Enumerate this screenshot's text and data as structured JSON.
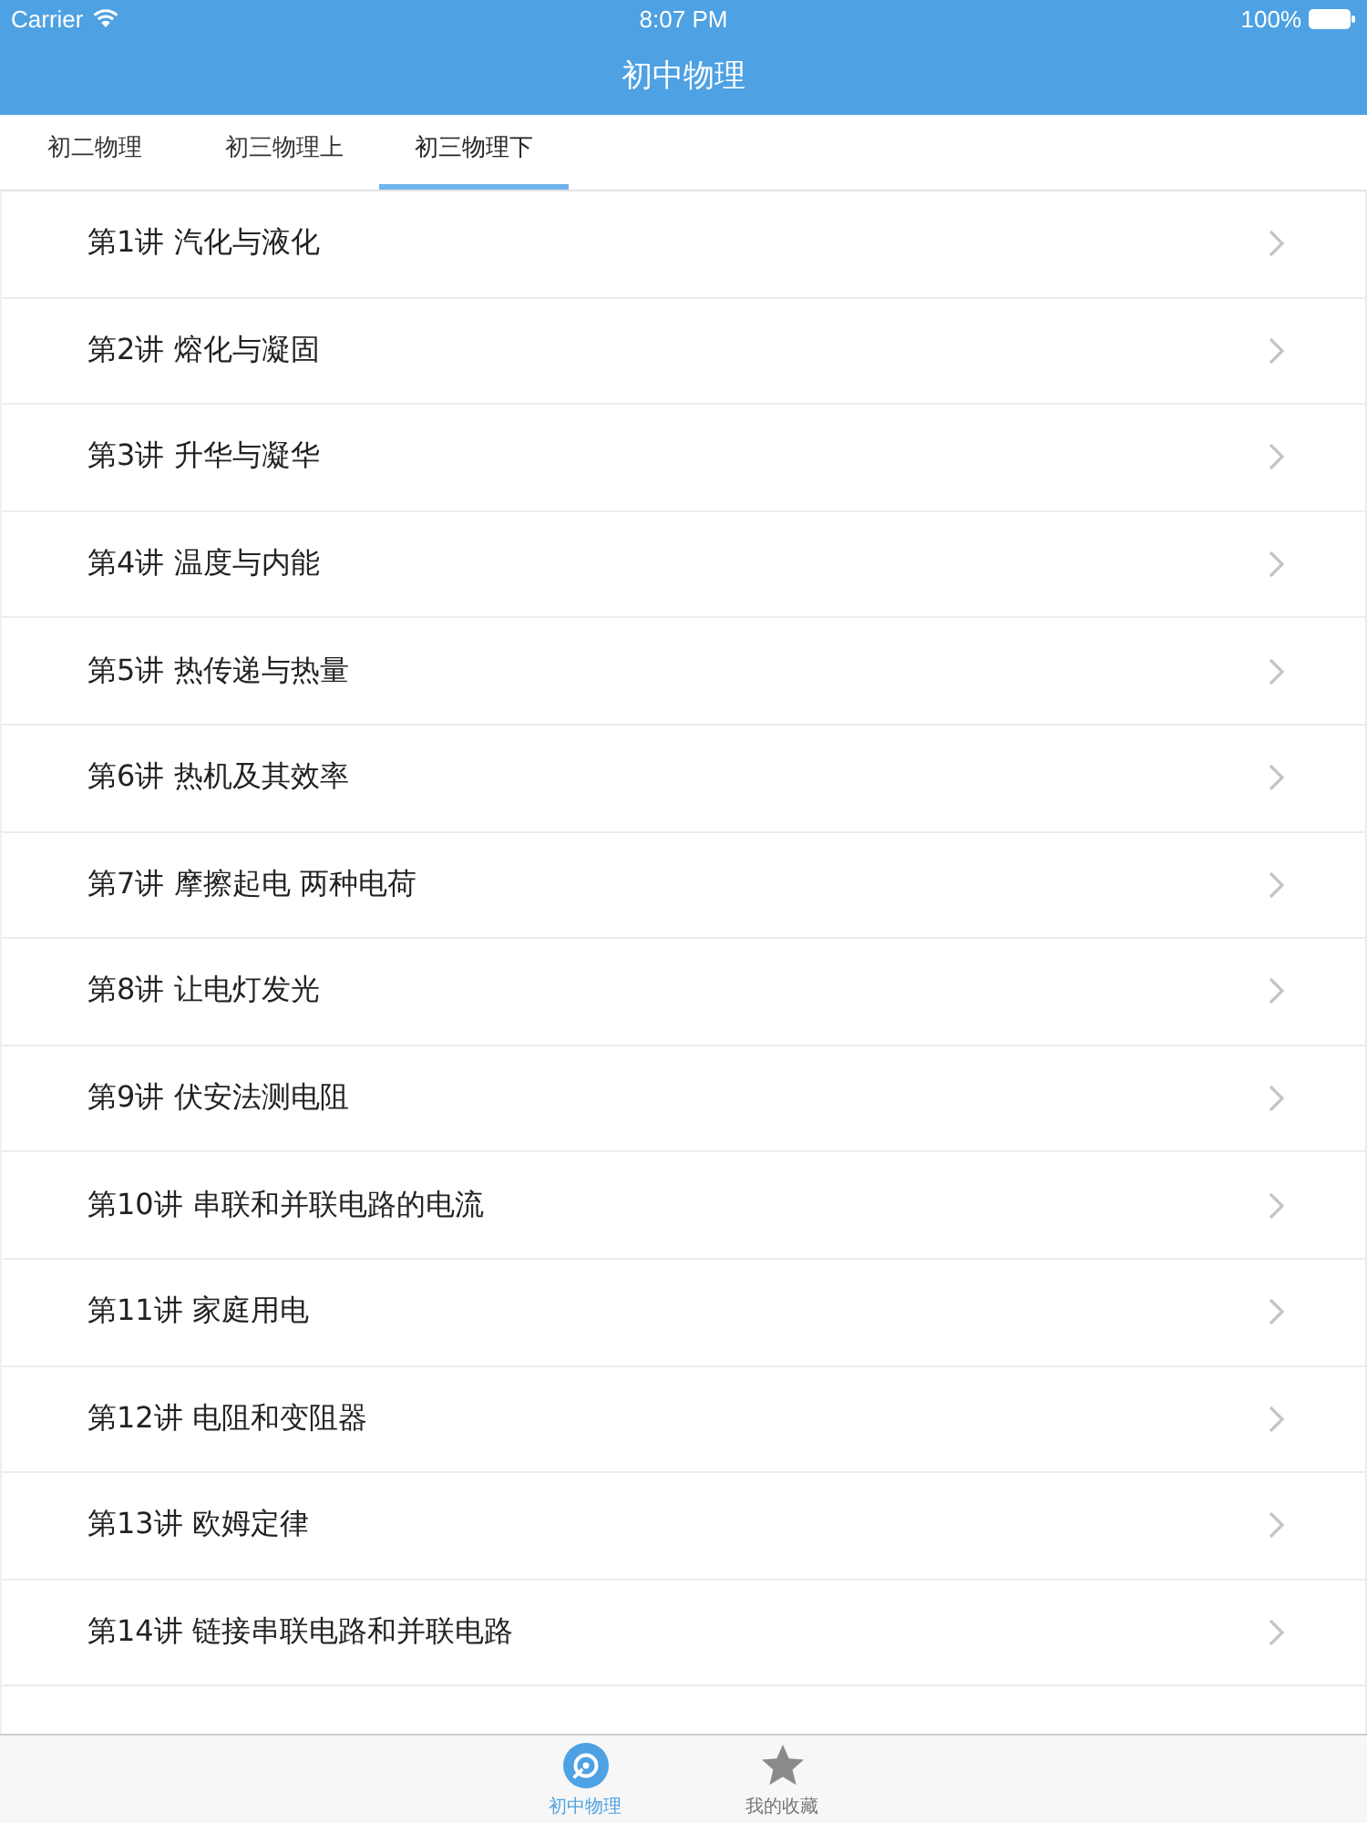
{
  "status_bar": {
    "carrier": "Carrier",
    "time": "8:07 PM",
    "battery": "100%"
  },
  "nav_bar": {
    "title": "初中物理"
  },
  "tabs": [
    {
      "label": "初二物理",
      "selected": false
    },
    {
      "label": "初三物理上",
      "selected": false
    },
    {
      "label": "初三物理下",
      "selected": true
    }
  ],
  "lessons": [
    {
      "title": "第1讲 汽化与液化"
    },
    {
      "title": "第2讲 熔化与凝固"
    },
    {
      "title": "第3讲 升华与凝华"
    },
    {
      "title": "第4讲 温度与内能"
    },
    {
      "title": "第5讲 热传递与热量"
    },
    {
      "title": "第6讲 热机及其效率"
    },
    {
      "title": "第7讲 摩擦起电 两种电荷"
    },
    {
      "title": "第8讲 让电灯发光"
    },
    {
      "title": "第9讲 伏安法测电阻"
    },
    {
      "title": "第10讲 串联和并联电路的电流"
    },
    {
      "title": "第11讲 家庭用电"
    },
    {
      "title": "第12讲 电阻和变阻器"
    },
    {
      "title": "第13讲 欧姆定律"
    },
    {
      "title": "第14讲 链接串联电路和并联电路"
    }
  ],
  "tab_bar": {
    "items": [
      {
        "label": "初中物理",
        "kind": "disc",
        "selected": true
      },
      {
        "label": "我的收藏",
        "kind": "star",
        "selected": false
      }
    ]
  }
}
